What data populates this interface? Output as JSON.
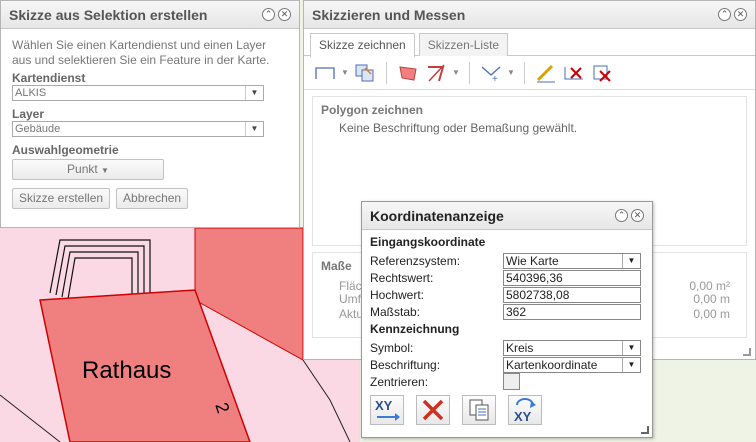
{
  "map": {
    "building_label": "Rathaus",
    "parcel_number": "2"
  },
  "left_panel": {
    "title": "Skizze aus Selektion erstellen",
    "description": "Wählen Sie einen Kartendienst und einen Layer aus und selektieren Sie ein Feature in der Karte.",
    "kartendienst_label": "Kartendienst",
    "kartendienst_value": "ALKIS",
    "layer_label": "Layer",
    "layer_value": "Gebäude",
    "geometrie_label": "Auswahlgeometrie",
    "geometrie_value": "Punkt",
    "create_button": "Skizze erstellen",
    "cancel_button": "Abbrechen"
  },
  "right_panel": {
    "title": "Skizzieren und Messen",
    "tabs": [
      {
        "label": "Skizze zeichnen",
        "active": true
      },
      {
        "label": "Skizzen-Liste",
        "active": false
      }
    ],
    "polygon_title": "Polygon zeichnen",
    "polygon_hint": "Keine Beschriftung oder Bemaßung gewählt.",
    "masse_title": "Maße",
    "masse_rows": [
      {
        "label": "Fläc",
        "value": "0,00 m²"
      },
      {
        "label": "Umf",
        "value": "0,00 m"
      },
      {
        "label": "Aktu",
        "value": "0,00 m"
      }
    ]
  },
  "coord_dialog": {
    "title": "Koordinatenanzeige",
    "input_section": "Eingangskoordinate",
    "ref_label": "Referenzsystem:",
    "ref_value": "Wie Karte",
    "rechtswert_label": "Rechtswert:",
    "rechtswert_value": "540396,36",
    "hochwert_label": "Hochwert:",
    "hochwert_value": "5802738,08",
    "massstab_label": "Maßstab:",
    "massstab_value": "362",
    "kennzeichnung_section": "Kennzeichnung",
    "symbol_label": "Symbol:",
    "symbol_value": "Kreis",
    "beschriftung_label": "Beschriftung:",
    "beschriftung_value": "Kartenkoordinate",
    "zentrieren_label": "Zentrieren:"
  },
  "colors": {
    "building_fill": "#f08080",
    "building_stroke": "#d00000",
    "parcel_fill": "#fbd9e4",
    "map_background": "#eef3e5"
  }
}
